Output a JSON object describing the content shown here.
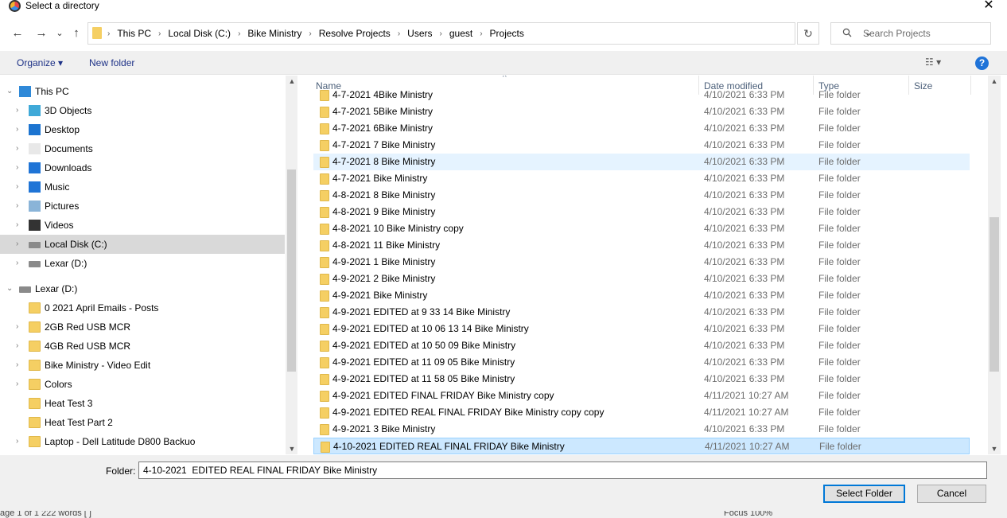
{
  "window": {
    "title": "Select a directory",
    "close_glyph": "✕"
  },
  "nav": {
    "back": "←",
    "forward": "→",
    "recent": "⌄",
    "up": "↑"
  },
  "address": {
    "crumbs": [
      "This PC",
      "Local Disk (C:)",
      "Bike Ministry",
      "Resolve Projects",
      "Users",
      "guest",
      "Projects"
    ],
    "lead_sep": "›",
    "dropdown": "⌄",
    "refresh": "↻"
  },
  "search": {
    "placeholder": "Search Projects",
    "icon": "search-icon"
  },
  "toolbar": {
    "organize": "Organize ▾",
    "new_folder": "New folder",
    "view": "☷ ▾",
    "help": "?"
  },
  "sidebar": {
    "items": [
      {
        "label": "This PC",
        "icon": "pc-icon",
        "chev": "⌄"
      },
      {
        "label": "3D Objects",
        "icon": "cube-icon",
        "chev": "›"
      },
      {
        "label": "Desktop",
        "icon": "desktop-icon",
        "chev": "›"
      },
      {
        "label": "Documents",
        "icon": "document-icon",
        "chev": "›"
      },
      {
        "label": "Downloads",
        "icon": "download-icon",
        "chev": "›"
      },
      {
        "label": "Music",
        "icon": "music-icon",
        "chev": "›"
      },
      {
        "label": "Pictures",
        "icon": "pictures-icon",
        "chev": "›"
      },
      {
        "label": "Videos",
        "icon": "video-icon",
        "chev": "›"
      },
      {
        "label": "Local Disk (C:)",
        "icon": "drive-icon",
        "chev": "›",
        "selected": true
      },
      {
        "label": "Lexar (D:)",
        "icon": "drive-icon",
        "chev": "›"
      },
      {
        "label": "Lexar (D:)",
        "icon": "drive-icon",
        "chev": "⌄"
      },
      {
        "label": "0 2021 April Emails - Posts",
        "icon": "folder-icon",
        "chev": ""
      },
      {
        "label": "2GB Red USB MCR",
        "icon": "folder-icon",
        "chev": "›"
      },
      {
        "label": "4GB Red USB MCR",
        "icon": "folder-icon",
        "chev": "›"
      },
      {
        "label": "Bike Ministry - Video Edit",
        "icon": "folder-icon",
        "chev": "›"
      },
      {
        "label": "Colors",
        "icon": "folder-icon",
        "chev": "›"
      },
      {
        "label": "Heat Test 3",
        "icon": "folder-icon",
        "chev": ""
      },
      {
        "label": "Heat Test Part 2",
        "icon": "folder-icon",
        "chev": ""
      },
      {
        "label": "Laptop - Dell Latitude D800 Backuo",
        "icon": "folder-icon",
        "chev": "›"
      }
    ]
  },
  "columns": {
    "name": "Name",
    "date": "Date modified",
    "type": "Type",
    "size": "Size",
    "sort_glyph": "^"
  },
  "files": [
    {
      "name": "4-7-2021 4Bike Ministry",
      "date": "4/10/2021 6:33 PM",
      "type": "File folder"
    },
    {
      "name": "4-7-2021 5Bike Ministry",
      "date": "4/10/2021 6:33 PM",
      "type": "File folder"
    },
    {
      "name": "4-7-2021 6Bike Ministry",
      "date": "4/10/2021 6:33 PM",
      "type": "File folder"
    },
    {
      "name": "4-7-2021 7 Bike Ministry",
      "date": "4/10/2021 6:33 PM",
      "type": "File folder"
    },
    {
      "name": "4-7-2021 8 Bike Ministry",
      "date": "4/10/2021 6:33 PM",
      "type": "File folder",
      "state": "hover"
    },
    {
      "name": "4-7-2021 Bike Ministry",
      "date": "4/10/2021 6:33 PM",
      "type": "File folder"
    },
    {
      "name": "4-8-2021 8 Bike Ministry",
      "date": "4/10/2021 6:33 PM",
      "type": "File folder"
    },
    {
      "name": "4-8-2021 9 Bike Ministry",
      "date": "4/10/2021 6:33 PM",
      "type": "File folder"
    },
    {
      "name": "4-8-2021 10 Bike Ministry copy",
      "date": "4/10/2021 6:33 PM",
      "type": "File folder"
    },
    {
      "name": "4-8-2021 11 Bike Ministry",
      "date": "4/10/2021 6:33 PM",
      "type": "File folder"
    },
    {
      "name": "4-9-2021  1 Bike Ministry",
      "date": "4/10/2021 6:33 PM",
      "type": "File folder"
    },
    {
      "name": "4-9-2021  2 Bike Ministry",
      "date": "4/10/2021 6:33 PM",
      "type": "File folder"
    },
    {
      "name": "4-9-2021  Bike Ministry",
      "date": "4/10/2021 6:33 PM",
      "type": "File folder"
    },
    {
      "name": "4-9-2021  EDITED at 9 33 14 Bike Ministry",
      "date": "4/10/2021 6:33 PM",
      "type": "File folder"
    },
    {
      "name": "4-9-2021  EDITED at 10 06 13 14 Bike Ministry",
      "date": "4/10/2021 6:33 PM",
      "type": "File folder"
    },
    {
      "name": "4-9-2021  EDITED at 10 50 09 Bike Ministry",
      "date": "4/10/2021 6:33 PM",
      "type": "File folder"
    },
    {
      "name": "4-9-2021  EDITED at 11 09 05 Bike Ministry",
      "date": "4/10/2021 6:33 PM",
      "type": "File folder"
    },
    {
      "name": "4-9-2021  EDITED at 11 58 05 Bike Ministry",
      "date": "4/10/2021 6:33 PM",
      "type": "File folder"
    },
    {
      "name": "4-9-2021  EDITED FINAL FRIDAY Bike Ministry copy",
      "date": "4/11/2021 10:27 AM",
      "type": "File folder"
    },
    {
      "name": "4-9-2021  EDITED REAL FINAL FRIDAY Bike Ministry copy copy",
      "date": "4/11/2021 10:27 AM",
      "type": "File folder"
    },
    {
      "name": "4-9-2021 3 Bike Ministry",
      "date": "4/10/2021 6:33 PM",
      "type": "File folder"
    },
    {
      "name": "4-10-2021  EDITED REAL FINAL FRIDAY Bike Ministry",
      "date": "4/11/2021 10:27 AM",
      "type": "File folder",
      "state": "selected"
    }
  ],
  "footer": {
    "folder_label": "Folder:",
    "folder_value": "4-10-2021  EDITED REAL FINAL FRIDAY Bike Ministry",
    "select_button": "Select Folder",
    "cancel_button": "Cancel"
  },
  "background_status": {
    "left": "age 1 of 1     222 words   [ ]",
    "right": "Focus                    100%"
  }
}
